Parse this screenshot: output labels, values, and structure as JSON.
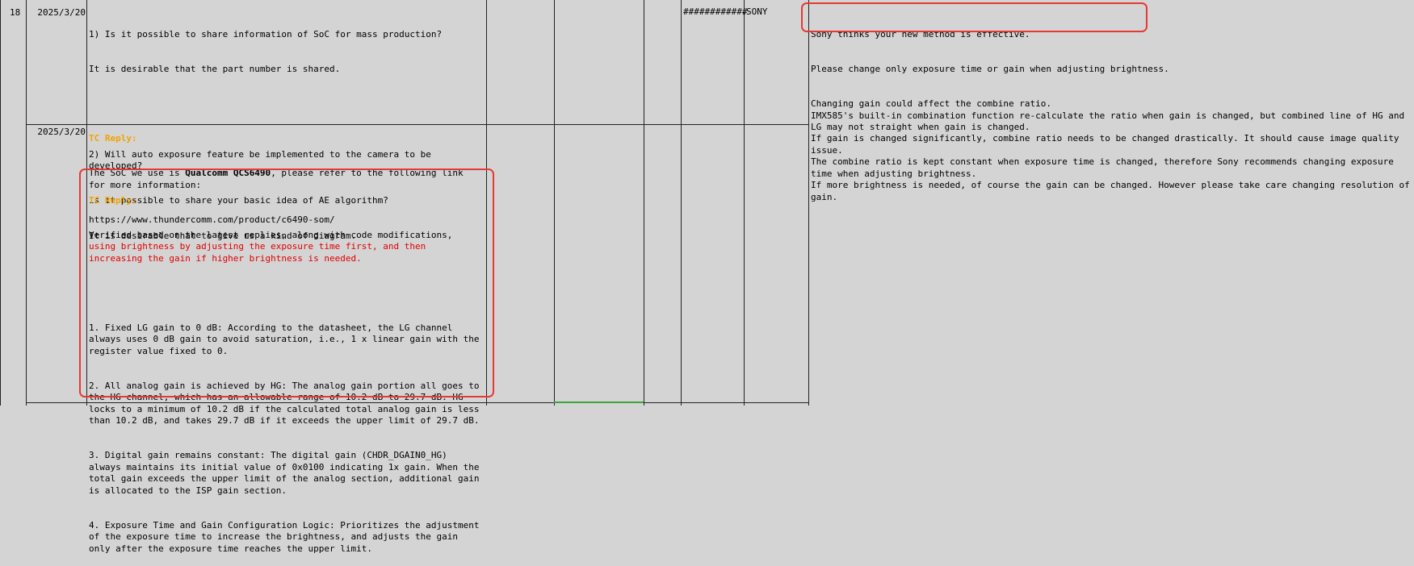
{
  "row_number": "18",
  "entries": [
    {
      "date": "2025/3/20",
      "q_lines": [
        "1) Is it possible to share information of SoC for mass production?",
        "It is desirable that the part number is shared."
      ],
      "tc_label": "TC Reply:",
      "reply_prefix": "The SoC we use is ",
      "reply_bold": "Qualcomm QCS6490",
      "reply_suffix": ", please refer to the following link for more information:",
      "link": "https://www.thundercomm.com/product/c6490-som/"
    },
    {
      "date": "2025/3/20",
      "q_lines": [
        "2) Will auto exposure feature be implemented to the camera to be developed?",
        "Is it possible to share your basic idea of AE algorithm?",
        "It is desirable that to give us a kind of diagram."
      ],
      "tc_label": "TC Reply:",
      "verify_prefix": "Verified based on the latest replies, along with code modifications, ",
      "verify_red": "using brightness by adjusting the exposure time first, and then increasing the gain if higher brightness is needed.",
      "points": [
        "1. Fixed LG gain to 0 dB: According to the datasheet, the LG channel always uses 0 dB gain to avoid saturation, i.e., 1 x linear gain with the register value fixed to 0.",
        "2. All analog gain is achieved by HG: The analog gain portion all goes to the HG channel, which has an allowable range of 10.2 dB to 29.7 dB. HG locks to a minimum of 10.2 dB if the calculated total analog gain is less than 10.2 dB, and takes 29.7 dB if it exceeds the upper limit of 29.7 dB.",
        "3. Digital gain remains constant: The digital gain (CHDR_DGAIN0_HG) always maintains its initial value of 0x0100 indicating 1x gain. When the total gain exceeds the upper limit of the analog section, additional gain is allocated to the ISP gain section.",
        "4. Exposure Time and Gain Configuration Logic: Prioritizes the adjustment of the exposure time to increase the brightness, and adjusts the gain only after the exposure time reaches the upper limit."
      ]
    }
  ],
  "hash_cell": "############",
  "vendor": "SONY",
  "sony_reply": {
    "highlight_lines": [
      "Sony thinks your new method is effective.",
      "Please change only exposure time or gain when adjusting brightness."
    ],
    "body": "Changing gain could affect the combine ratio.\nIMX585's built-in combination function re-calculate the ratio when gain is changed, but combined line of HG and LG may not straight when gain is changed.\nIf gain is changed significantly, combine ratio needs to be changed drastically. It should cause image quality issue.\nThe combine ratio is kept constant when exposure time is changed, therefore Sony recommends changing exposure time when adjusting brightness.\nIf more brightness is needed, of course the gain can be changed. However please take care changing resolution of gain."
  }
}
